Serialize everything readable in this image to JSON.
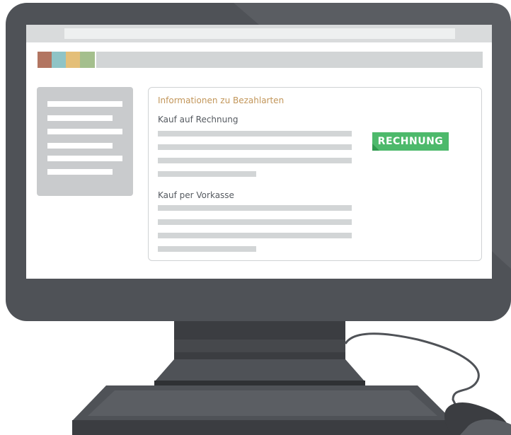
{
  "colors": {
    "bezel": "#4f5257",
    "bezel_highlight": "#5a5d62",
    "stand": "#3b3d41",
    "screen": "#ffffff",
    "accent": "#c2965a",
    "badge": "#4db96b",
    "swatches": [
      "#b27561",
      "#8fc4c6",
      "#e4bf78",
      "#a4bf8d"
    ]
  },
  "browser": {
    "address_bar": {
      "value": ""
    }
  },
  "content": {
    "panel": {
      "title": "Informationen zu Bezahlarten",
      "sections": [
        {
          "heading": "Kauf auf Rechnung"
        },
        {
          "heading": "Kauf per Vorkasse"
        }
      ],
      "badge": "RECHNUNG"
    }
  }
}
